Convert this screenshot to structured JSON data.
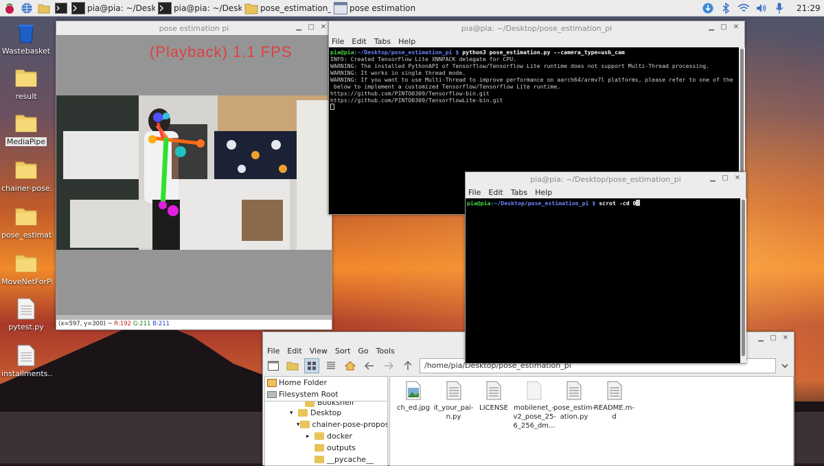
{
  "taskbar": {
    "tasks": [
      {
        "label": "pia@pia: ~/Desktop/...",
        "icon": "terminal-icon"
      },
      {
        "label": "pia@pia: ~/Desktop/...",
        "icon": "terminal-icon"
      },
      {
        "label": "pose_estimation_pi",
        "icon": "folder-icon"
      },
      {
        "label": "pose estimation pi",
        "icon": "image-window-icon"
      }
    ],
    "clock": "21:29"
  },
  "desktop": {
    "icons": [
      {
        "label": "Wastebasket",
        "icon": "trash-icon"
      },
      {
        "label": "result",
        "icon": "folder-icon"
      },
      {
        "label": "MediaPipe",
        "icon": "folder-icon"
      },
      {
        "label": "chainer-pose...",
        "icon": "folder-icon"
      },
      {
        "label": "pose_estimat...",
        "icon": "folder-icon"
      },
      {
        "label": "MoveNetForPi",
        "icon": "folder-icon"
      },
      {
        "label": "pytest.py",
        "icon": "python-file-icon"
      },
      {
        "label": "installments...",
        "icon": "text-file-icon"
      }
    ]
  },
  "pose_window": {
    "title": "pose estimation pi",
    "overlay_text": "(Playback) 1.1 FPS",
    "status": {
      "coords": "(x=597, y=300) ~",
      "r": "R:192",
      "g": "G:211",
      "b": "B:211"
    }
  },
  "terminal1": {
    "title": "pia@pia: ~/Desktop/pose_estimation_pi",
    "menu": [
      "File",
      "Edit",
      "Tabs",
      "Help"
    ],
    "prompt_user": "pia@pia",
    "prompt_path": ":~/Desktop/pose_estimation_pi $",
    "command": " python3 pose_estimation.py --camera_type=usb_cam",
    "output": [
      "INFO: Created TensorFlow Lite XNNPACK delegate for CPU.",
      "WARNING: The installed PythonAPI of Tensorflow/Tensorflow Lite runtime does not support Multi-Thread processing.",
      "WARNING: It works in single thread mode.",
      "WARNING: If you want to use Multi-Thread to improve performance on aarch64/armv7l platforms, please refer to one of the",
      " below to implement a customized Tensorflow/Tensorflow Lite runtime.",
      "https://github.com/PINTO0309/Tensorflow-bin.git",
      "https://github.com/PINTO0309/TensorflowLite-bin.git"
    ]
  },
  "terminal2": {
    "title": "pia@pia: ~/Desktop/pose_estimation_pi",
    "menu": [
      "File",
      "Edit",
      "Tabs",
      "Help"
    ],
    "prompt_user": "pia@pia",
    "prompt_path": ":~/Desktop/pose_estimation_pi $",
    "command": " scrot -cd 0"
  },
  "file_manager": {
    "menu": [
      "File",
      "Edit",
      "View",
      "Sort",
      "Go",
      "Tools"
    ],
    "path": "/home/pia/Desktop/pose_estimation_pi",
    "places": [
      "Home Folder",
      "Filesystem Root"
    ],
    "tree": [
      {
        "label": "Bookshelf",
        "expander": ""
      },
      {
        "label": "Desktop",
        "expander": "▾"
      },
      {
        "label": "chainer-pose-proposal-n",
        "expander": "▾"
      },
      {
        "label": "docker",
        "expander": "▸"
      },
      {
        "label": "outputs",
        "expander": ""
      },
      {
        "label": "__pycache__",
        "expander": ""
      }
    ],
    "files": [
      {
        "name": "ch_ed.jpg",
        "icon": "image-file-icon"
      },
      {
        "name": "it_your_pai-n.py",
        "icon": "python-file-icon"
      },
      {
        "name": "LICENSE",
        "icon": "text-file-icon"
      },
      {
        "name": "mobilenet_-v2_pose_25-6_256_dm...",
        "icon": "model-file-icon"
      },
      {
        "name": "pose_estim-ation.py",
        "icon": "python-file-icon"
      },
      {
        "name": "README.m-d",
        "icon": "markdown-file-icon"
      }
    ]
  },
  "colors": {
    "prompt_green": "#46d846",
    "prompt_blue": "#6b87ff",
    "overlay_red": "#e04040"
  }
}
